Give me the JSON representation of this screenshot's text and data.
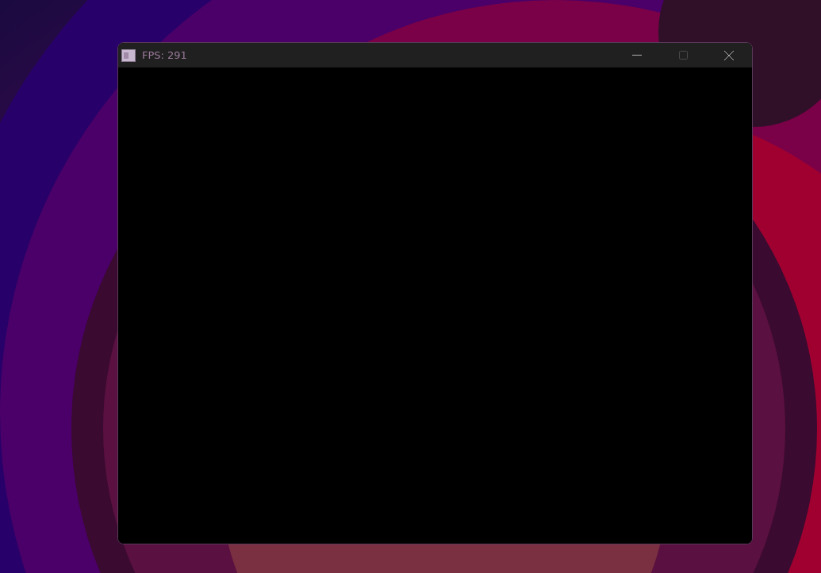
{
  "window": {
    "title": "FPS: 291",
    "active": false,
    "maximize_disabled": true
  }
}
